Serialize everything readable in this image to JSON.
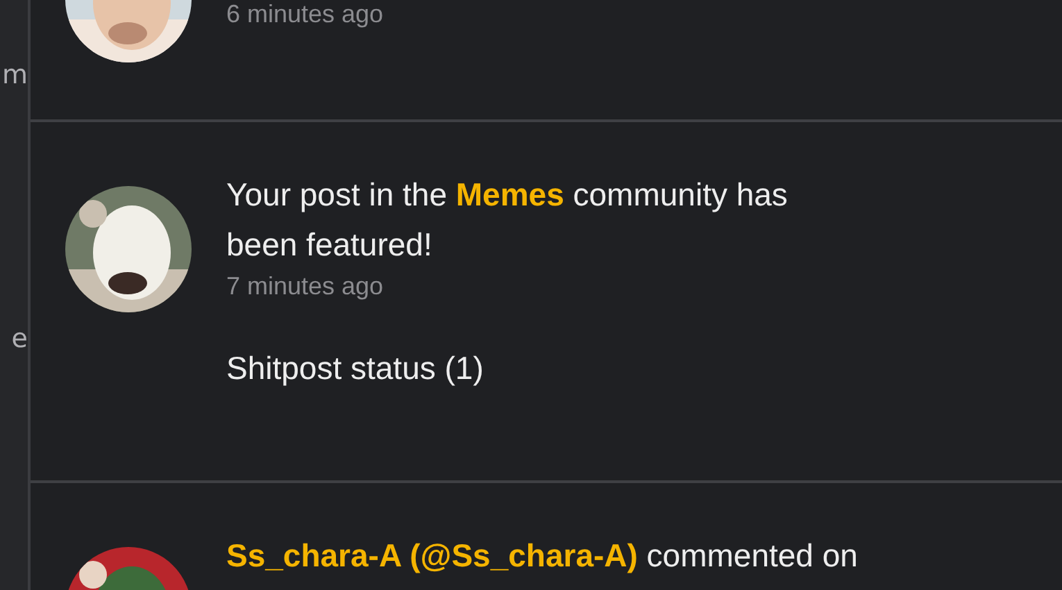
{
  "sidebar": {
    "texts": [
      "m",
      "e"
    ]
  },
  "notifications": [
    {
      "time": "6 minutes ago"
    },
    {
      "message": "Your post in the **Memes** community has been featured!",
      "time": "7 minutes ago",
      "detail": "Shitpost status (1)"
    },
    {
      "message": "**Ss_chara-A (@Ss_chara-A)** commented on"
    }
  ]
}
